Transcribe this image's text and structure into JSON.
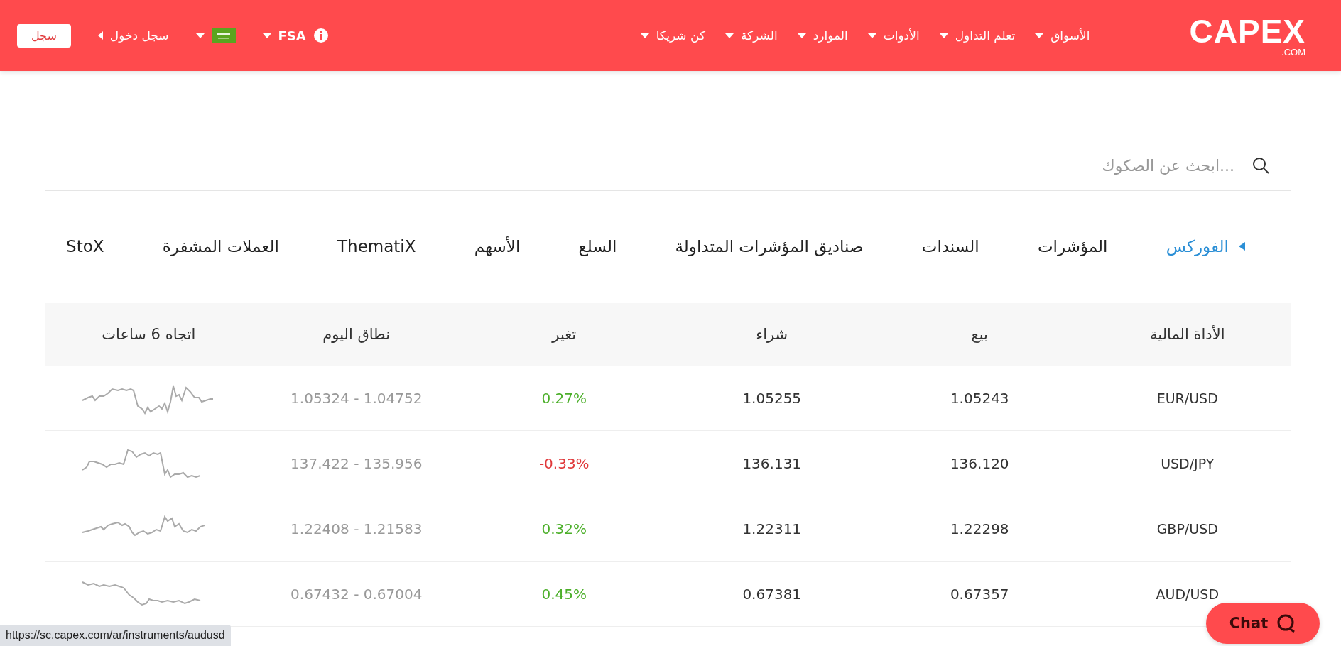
{
  "header": {
    "logo": "CAPEX",
    "logo_sub": ".COM",
    "nav": [
      {
        "label": "الأسواق"
      },
      {
        "label": "تعلم التداول"
      },
      {
        "label": "الأدوات"
      },
      {
        "label": "الموارد"
      },
      {
        "label": "الشركة"
      },
      {
        "label": "كن شريكا"
      }
    ],
    "regulator": "FSA",
    "login": "سجل دخول",
    "register": "سجل"
  },
  "search": {
    "placeholder": "...ابحث عن الصكوك"
  },
  "tabs": [
    {
      "label": "الفوركس",
      "selected": true
    },
    {
      "label": "المؤشرات",
      "selected": false
    },
    {
      "label": "السندات",
      "selected": false
    },
    {
      "label": "صناديق المؤشرات المتداولة",
      "selected": false
    },
    {
      "label": "السلع",
      "selected": false
    },
    {
      "label": "الأسهم",
      "selected": false
    },
    {
      "label": "ThematiX",
      "selected": false
    },
    {
      "label": "العملات المشفرة",
      "selected": false
    },
    {
      "label": "StoX",
      "selected": false
    }
  ],
  "table": {
    "columns": [
      "الأداة المالية",
      "بيع",
      "شراء",
      "تغير",
      "نطاق اليوم",
      "اتجاه 6 ساعات"
    ],
    "rows": [
      {
        "instrument": "EUR/USD",
        "sell": "1.05243",
        "buy": "1.05255",
        "change": "0.27%",
        "color": "#4caf2a",
        "range": "1.05324 - 1.04752"
      },
      {
        "instrument": "USD/JPY",
        "sell": "136.120",
        "buy": "136.131",
        "change": "-0.33%",
        "color": "#e0393b",
        "range": "137.422 - 135.956"
      },
      {
        "instrument": "GBP/USD",
        "sell": "1.22298",
        "buy": "1.22311",
        "change": "0.32%",
        "color": "#4caf2a",
        "range": "1.22408 - 1.21583"
      },
      {
        "instrument": "AUD/USD",
        "sell": "0.67357",
        "buy": "0.67381",
        "change": "0.45%",
        "color": "#4caf2a",
        "range": "0.67432 - 0.67004"
      }
    ]
  },
  "chat": {
    "label": "Chat"
  },
  "status_bar": {
    "url": "https://sc.capex.com/ar/instruments/audusd"
  }
}
